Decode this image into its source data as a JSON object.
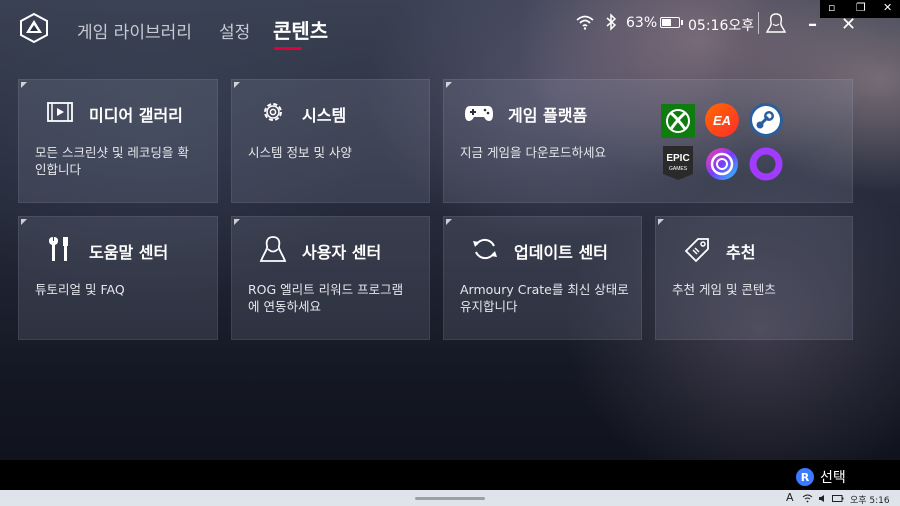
{
  "nav": {
    "tabs": [
      "게임 라이브러리",
      "설정",
      "콘텐츠"
    ],
    "active": "콘텐츠"
  },
  "status": {
    "battery_percent": "63%",
    "battery_level": 0.63,
    "time": "05:16오후"
  },
  "window": {
    "minimize": "–",
    "close": "✕",
    "small_min": "▫",
    "small_restore": "❐",
    "small_close": "✕"
  },
  "cards": [
    {
      "title": "미디어 갤러리",
      "desc_line1": "모든 스크린샷 및 레코딩을 확",
      "desc_line2": "인합니다",
      "icon": "media-gallery-icon"
    },
    {
      "title": "시스템",
      "desc_line1": "시스템 정보 및 사양",
      "desc_line2": "",
      "icon": "gear-icon"
    },
    {
      "title": "게임 플랫폼",
      "desc_line1": "지금 게임을 다운로드하세요",
      "desc_line2": "",
      "icon": "gamepad-icon"
    },
    {
      "title": "도움말 센터",
      "desc_line1": "튜토리얼 및 FAQ",
      "desc_line2": "",
      "icon": "tools-icon"
    },
    {
      "title": "사용자 센터",
      "desc_line1": "ROG 엘리트 리워드 프로그램",
      "desc_line2": "에 연동하세요",
      "icon": "user-center-icon"
    },
    {
      "title": "업데이트 센터",
      "desc_line1": "Armoury Crate를 최신 상태로",
      "desc_line2": "유지합니다",
      "icon": "refresh-icon"
    },
    {
      "title": "추천",
      "desc_line1": "추천 게임 및 콘텐츠",
      "desc_line2": "",
      "icon": "tag-icon"
    }
  ],
  "platforms": [
    {
      "name": "xbox-icon",
      "color": "#107c10"
    },
    {
      "name": "ea-icon",
      "color": "#ff4a1c"
    },
    {
      "name": "steam-icon",
      "color": "#1b2838"
    },
    {
      "name": "epic-games-icon",
      "color": "#2a2a2a",
      "label1": "EPIC",
      "label2": "GAMES"
    },
    {
      "name": "ubisoft-icon",
      "color": "#7a2bd6"
    },
    {
      "name": "gog-icon",
      "color": "#8a2be2"
    }
  ],
  "bottom": {
    "button_letter": "R",
    "select_label": "선택"
  },
  "taskbar": {
    "time": "오후 5:16",
    "ime": "A"
  }
}
